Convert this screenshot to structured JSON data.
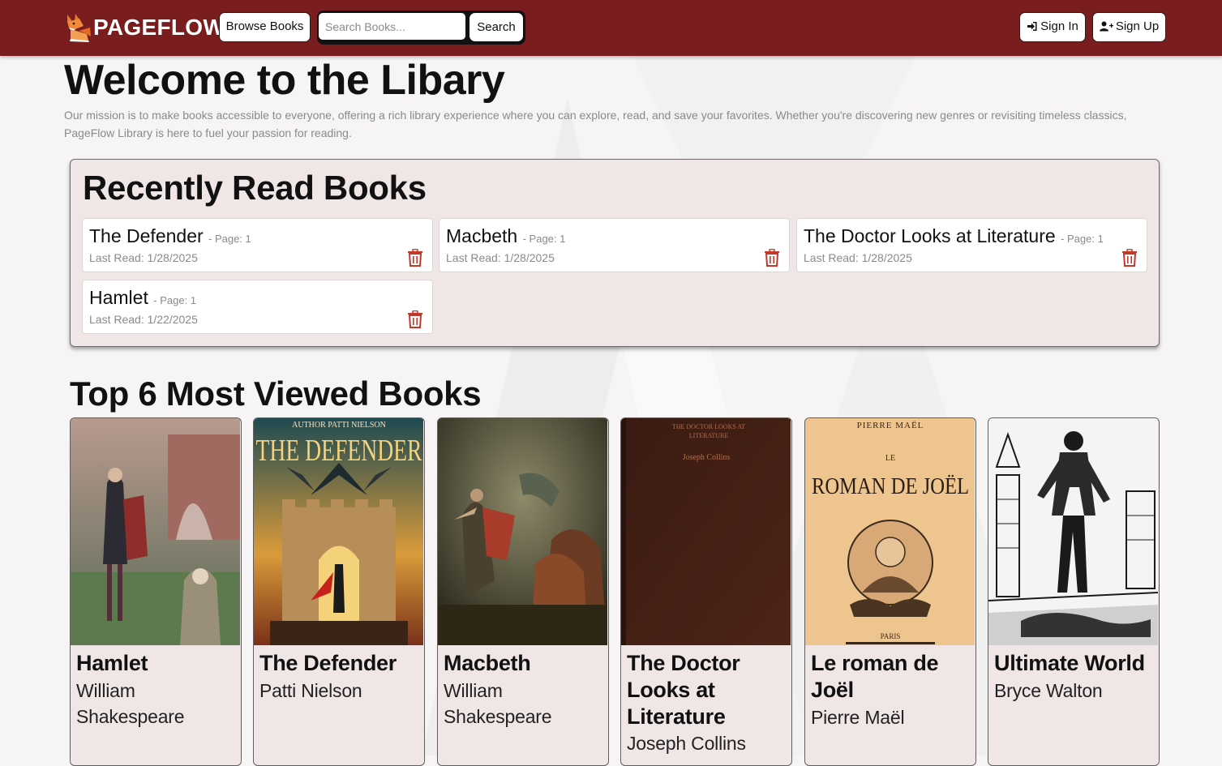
{
  "nav": {
    "brand": "PAGEFLOW",
    "browse_label": "Browse Books",
    "search_placeholder": "Search Books...",
    "search_label": "Search",
    "signin_label": "Sign In",
    "signup_label": "Sign Up"
  },
  "hero": {
    "title": "Welcome to the Libary",
    "mission": "Our mission is to make books accessible to everyone, offering a rich library experience where you can explore, read, and save your favorites. Whether you're discovering new genres or revisiting timeless classics, PageFlow Library is here to fuel your passion for reading."
  },
  "recent": {
    "title": "Recently Read Books",
    "items": [
      {
        "title": "The Defender",
        "page": "- Page: 1",
        "last_read": "Last Read: 1/28/2025"
      },
      {
        "title": "Macbeth",
        "page": "- Page: 1",
        "last_read": "Last Read: 1/28/2025"
      },
      {
        "title": "The Doctor Looks at Literature",
        "page": "- Page: 1",
        "last_read": "Last Read: 1/28/2025"
      },
      {
        "title": "Hamlet",
        "page": "- Page: 1",
        "last_read": "Last Read: 1/22/2025"
      }
    ]
  },
  "top": {
    "title": "Top 6 Most Viewed Books",
    "books": [
      {
        "title": "Hamlet",
        "author": "William Shakespeare"
      },
      {
        "title": "The Defender",
        "author": "Patti Nielson"
      },
      {
        "title": "Macbeth",
        "author": "William Shakespeare"
      },
      {
        "title": "The Doctor Looks at Literature",
        "author": "Joseph Collins"
      },
      {
        "title": "Le roman de Joël",
        "author": "Pierre Maël"
      },
      {
        "title": "Ultimate World",
        "author": "Bryce Walton"
      }
    ]
  },
  "covers": {
    "defender": {
      "byline": "AUTHOR PATTI NIELSON",
      "title": "THE DEFENDER"
    },
    "doctor": {
      "title_line1": "THE DOCTOR LOOKS AT",
      "title_line2": "LITERATURE",
      "author": "Joseph Collins"
    },
    "joel": {
      "author": "PIERRE MAËL",
      "le": "LE",
      "title": "ROMAN DE JOËL",
      "city": "PARIS"
    }
  },
  "colors": {
    "navbar": "#7a1d1f",
    "trash": "#c0392b",
    "panel": "#efe6e5"
  },
  "icons": {
    "logo": "fox-book-icon",
    "signin": "sign-in-icon",
    "signup": "user-plus-icon",
    "trash": "trash-icon"
  }
}
